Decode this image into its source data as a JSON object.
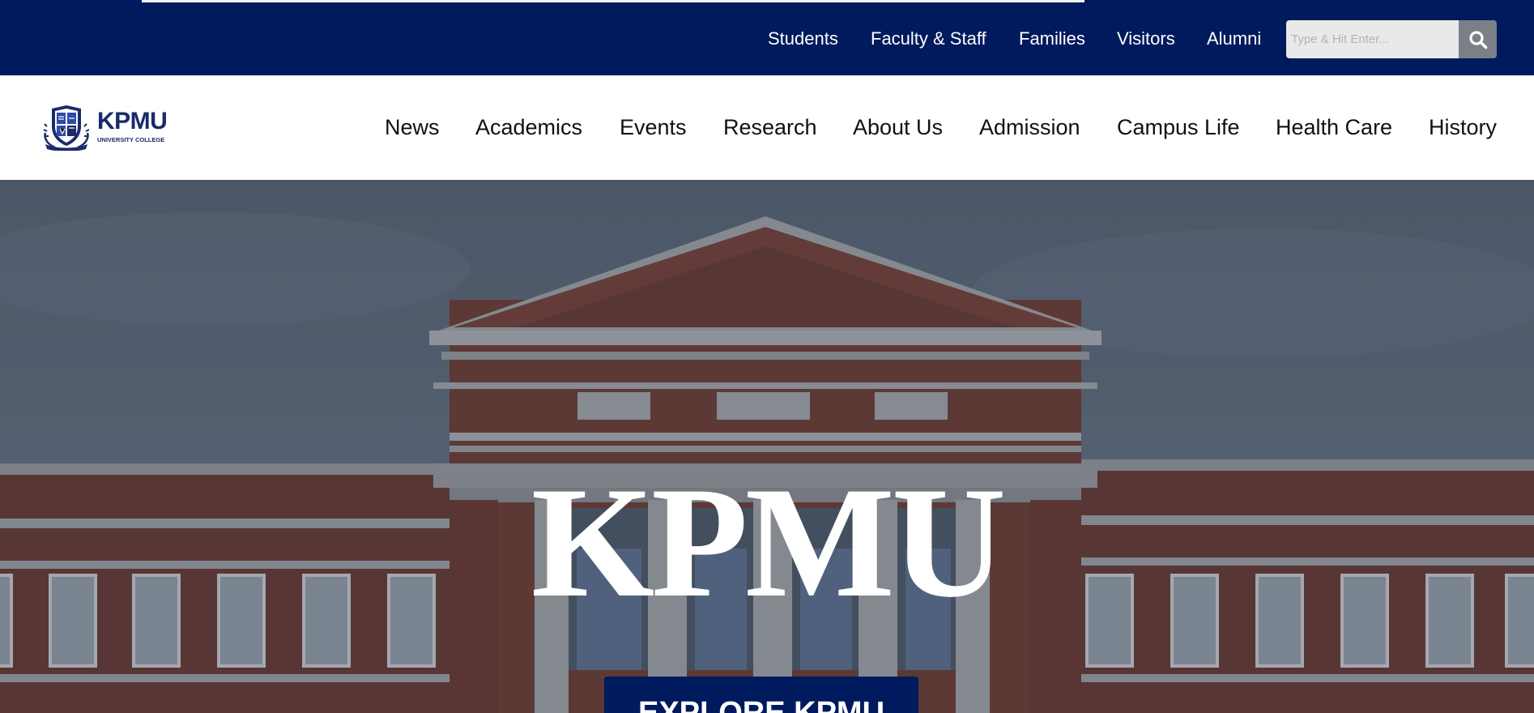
{
  "topbar": {
    "links": [
      "Students",
      "Faculty & Staff",
      "Families",
      "Visitors",
      "Alumni"
    ],
    "search": {
      "placeholder": "Type & Hit Enter...",
      "value": ""
    },
    "background_color": "#001a5e"
  },
  "header": {
    "logo": {
      "title": "KPMU",
      "subtitle": "UNIVERSITY COLLEGE",
      "icon": "university-crest-icon"
    },
    "nav": [
      "News",
      "Academics",
      "Events",
      "Research",
      "About Us",
      "Admission",
      "Campus Life",
      "Health Care",
      "History"
    ]
  },
  "hero": {
    "title": "KPMU",
    "button_label": "EXPLORE KPMU",
    "button_color": "#001a5e"
  }
}
